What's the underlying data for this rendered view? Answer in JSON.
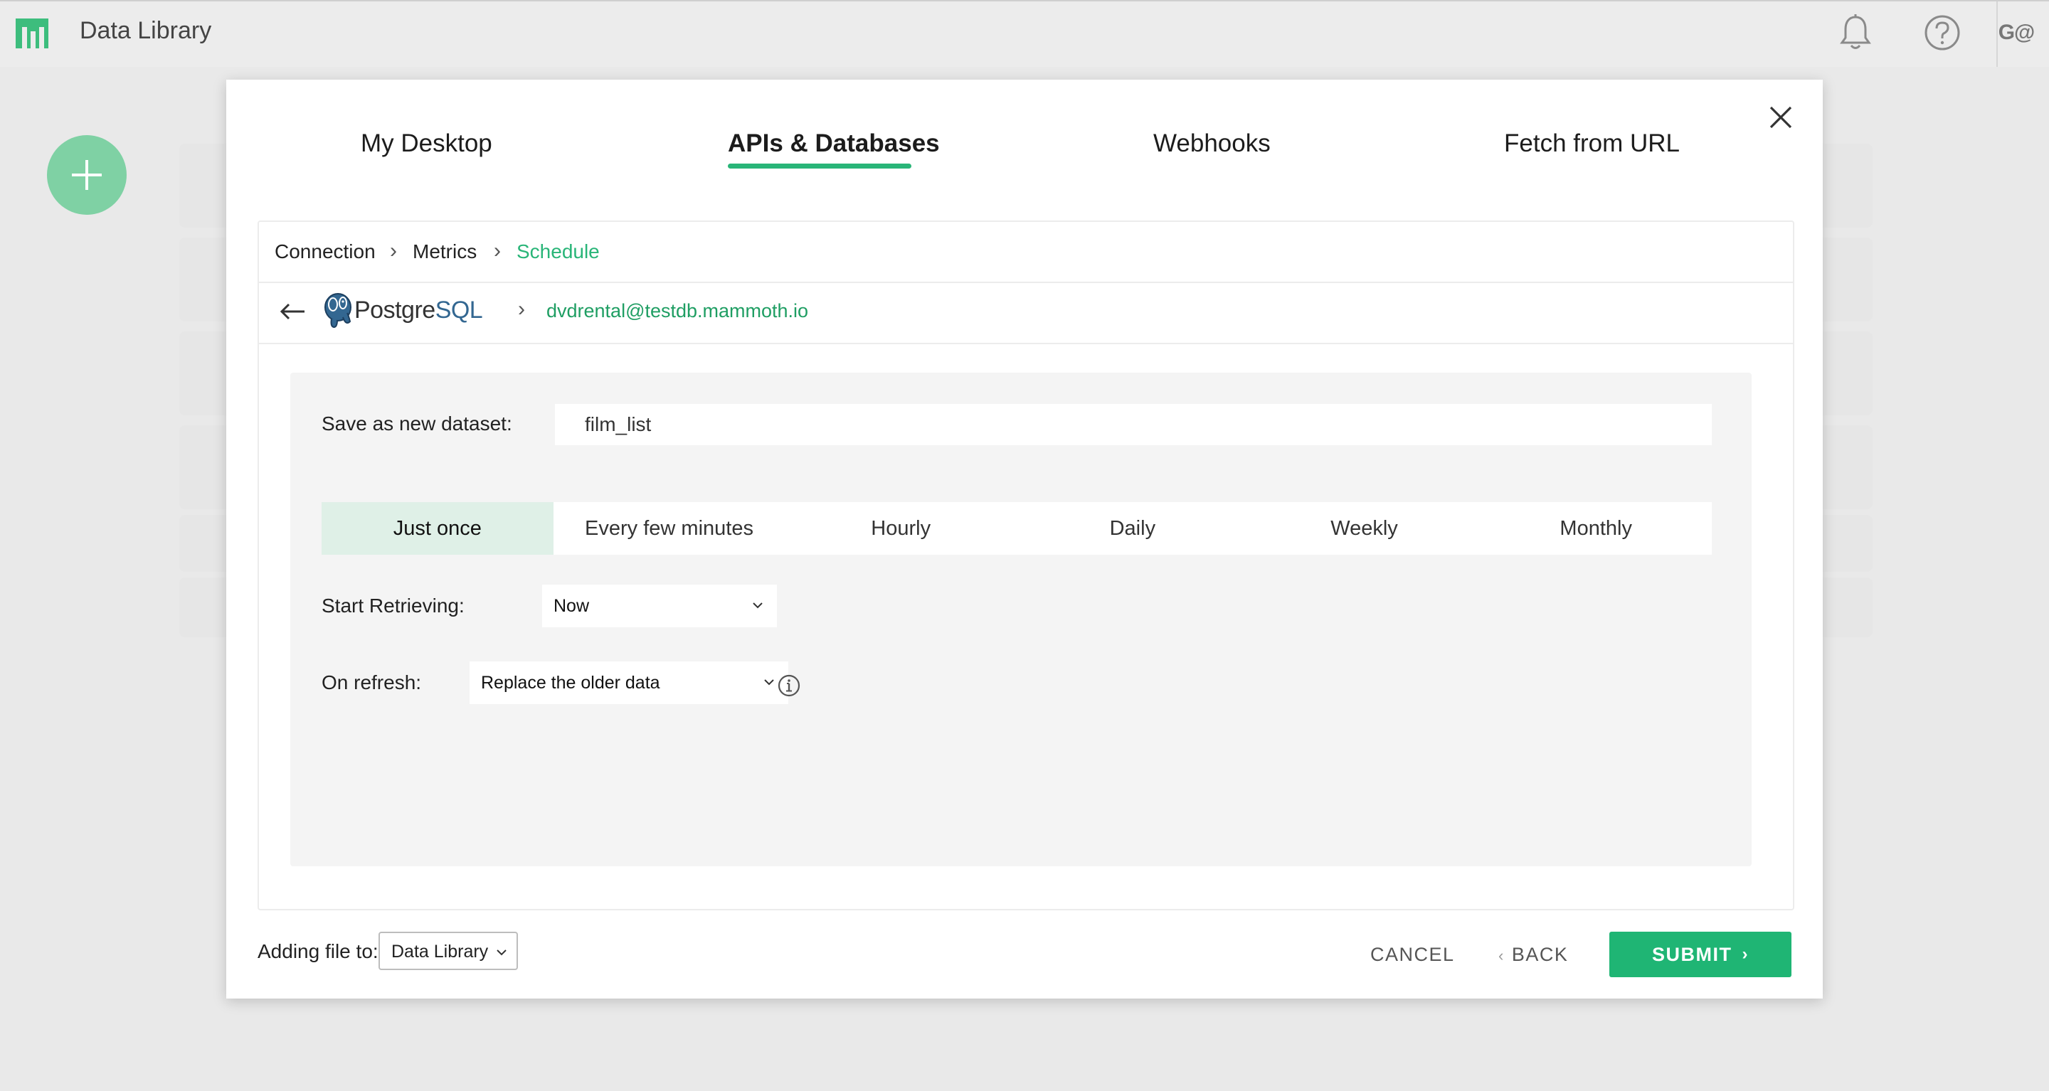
{
  "app": {
    "title": "Data Library",
    "user_initials": "G@",
    "background_partial_text": "e"
  },
  "modal": {
    "tabs": [
      {
        "label": "My Desktop",
        "active": false
      },
      {
        "label": "APIs & Databases",
        "active": true
      },
      {
        "label": "Webhooks",
        "active": false
      },
      {
        "label": "Fetch from URL",
        "active": false
      }
    ],
    "breadcrumbs": [
      {
        "label": "Connection",
        "current": false
      },
      {
        "label": "Metrics",
        "current": false
      },
      {
        "label": "Schedule",
        "current": true
      }
    ],
    "breadcrumb_separator": "›",
    "connection": {
      "source_logo_text_a": "Postgre",
      "source_logo_text_b": "SQL",
      "separator": "›",
      "name": "dvdrental@testdb.mammoth.io"
    },
    "form": {
      "dataset_label": "Save as new dataset:",
      "dataset_value": "film_list",
      "frequency_options": [
        "Just once",
        "Every few minutes",
        "Hourly",
        "Daily",
        "Weekly",
        "Monthly"
      ],
      "frequency_selected": "Just once",
      "start_label": "Start Retrieving:",
      "start_value": "Now",
      "refresh_label": "On refresh:",
      "refresh_value": "Replace the older data"
    },
    "footer": {
      "adding_label": "Adding file to:",
      "destination": "Data Library",
      "cancel_label": "CANCEL",
      "back_label": "BACK",
      "back_chevron": "‹",
      "submit_label": "SUBMIT",
      "submit_chevron": "›"
    }
  },
  "colors": {
    "accent": "#29b578",
    "submit": "#1fb574",
    "selected_frequency": "#dff0e7",
    "fab": "#7fd1a4",
    "postgres_blue": "#336791"
  },
  "icons": [
    "app-logo-icon",
    "bell-icon",
    "help-icon",
    "plus-icon",
    "close-icon",
    "back-arrow-icon",
    "postgresql-elephant-icon",
    "chevron-down-icon",
    "info-icon"
  ]
}
